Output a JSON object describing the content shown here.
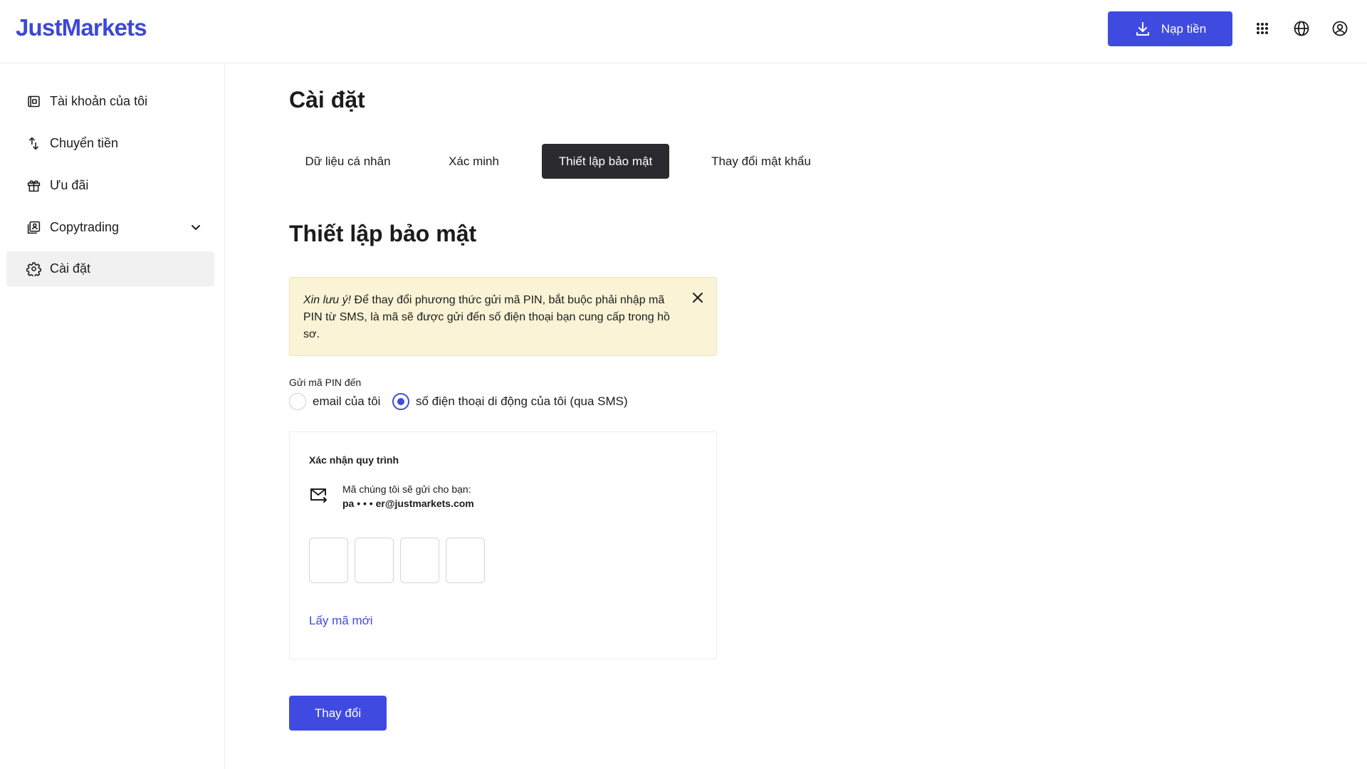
{
  "header": {
    "logo": "JustMarkets",
    "deposit_label": "Nạp tiền",
    "icons": [
      "apps-grid-icon",
      "globe-icon",
      "user-circle-icon"
    ]
  },
  "sidebar": {
    "items": [
      {
        "label": "Tài khoản của tôi",
        "icon": "wallet-icon"
      },
      {
        "label": "Chuyển tiền",
        "icon": "transfer-icon"
      },
      {
        "label": "Ưu đãi",
        "icon": "gift-icon"
      },
      {
        "label": "Copytrading",
        "icon": "copytrading-icon",
        "has_dropdown": true
      },
      {
        "label": "Cài đặt",
        "icon": "gear-icon",
        "active": true
      }
    ]
  },
  "main": {
    "title": "Cài đặt",
    "tabs": [
      {
        "label": "Dữ liệu cá nhân"
      },
      {
        "label": "Xác minh"
      },
      {
        "label": "Thiết lập bảo mật",
        "active": true
      },
      {
        "label": "Thay đổi mật khẩu"
      }
    ],
    "section_title": "Thiết lập bảo mật",
    "alert": {
      "emphasis": "Xin lưu ý!",
      "text": " Để thay đổi phương thức gửi mã PIN, bắt buộc phải nhập mã PIN từ SMS, là mã sẽ được gửi đến số điện thoại bạn cung cấp trong hồ sơ."
    },
    "pin_label": "Gửi mã PIN đến",
    "pin_options": [
      {
        "label": "email của tôi",
        "checked": false
      },
      {
        "label": "số điện thoại di động của tôi (qua SMS)",
        "checked": true
      }
    ],
    "confirm": {
      "title": "Xác nhận quy trình",
      "hint": "Mã chúng tôi sẽ gửi cho bạn:",
      "email": "pa • • • er@justmarkets.com",
      "digits": [
        "",
        "",
        "",
        ""
      ],
      "resend_label": "Lấy mã mới"
    },
    "submit_label": "Thay đổi"
  },
  "colors": {
    "accent": "#3f4be0",
    "logo": "#3d48d6",
    "alert_bg": "#fbf3d5",
    "active_tab_bg": "#2b2b2f"
  }
}
